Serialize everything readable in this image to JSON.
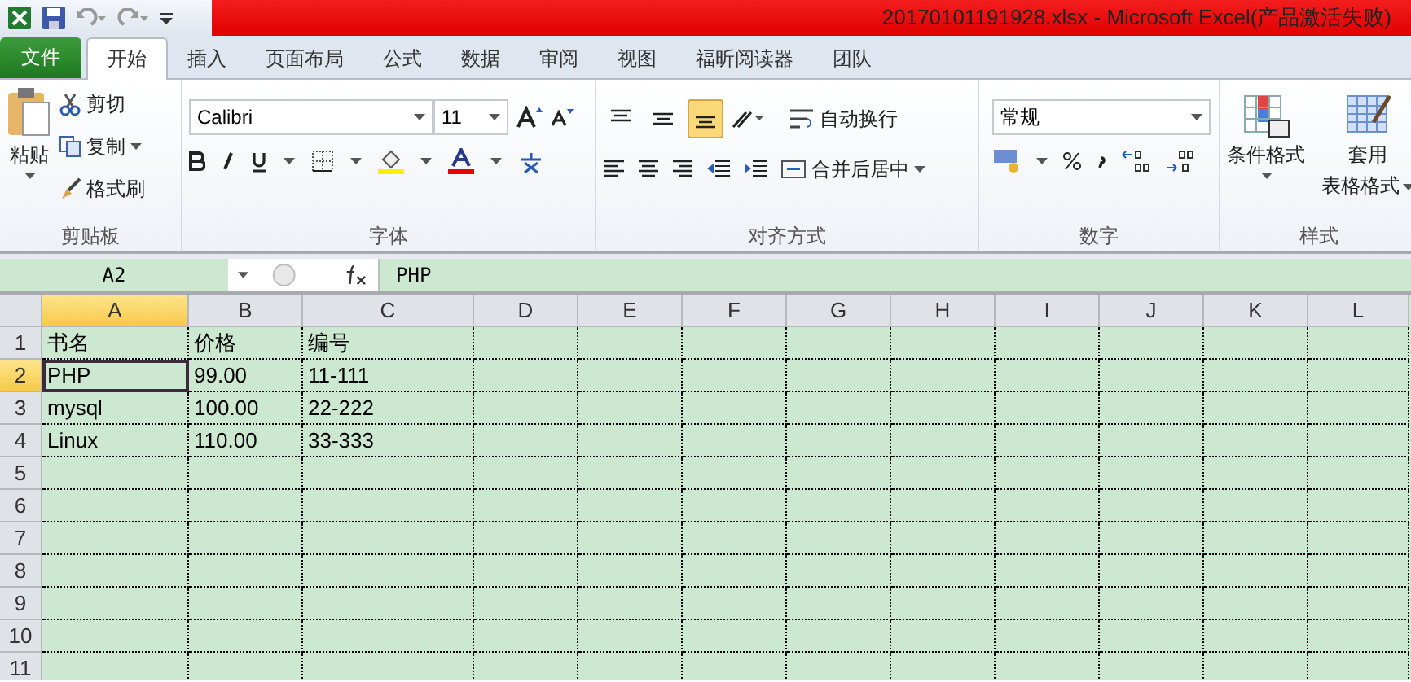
{
  "window": {
    "title": "20170101191928.xlsx  -  Microsoft Excel(产品激活失败)"
  },
  "file_menu": {
    "label": "文件"
  },
  "tabs": [
    {
      "label": "开始",
      "selected": true
    },
    {
      "label": "插入",
      "selected": false
    },
    {
      "label": "页面布局",
      "selected": false
    },
    {
      "label": "公式",
      "selected": false
    },
    {
      "label": "数据",
      "selected": false
    },
    {
      "label": "审阅",
      "selected": false
    },
    {
      "label": "视图",
      "selected": false
    },
    {
      "label": "福昕阅读器",
      "selected": false
    },
    {
      "label": "团队",
      "selected": false
    }
  ],
  "ribbon": {
    "clipboard": {
      "label": "剪贴板",
      "paste": "粘贴",
      "cut": "剪切",
      "copy": "复制",
      "format_painter": "格式刷"
    },
    "font": {
      "label": "字体",
      "font_name": "Calibri",
      "font_size": "11"
    },
    "alignment": {
      "label": "对齐方式",
      "wrap_text": "自动换行",
      "merge_center": "合并后居中",
      "bottom_align_selected": true
    },
    "number": {
      "label": "数字",
      "format": "常规"
    },
    "styles": {
      "label": "样式",
      "conditional_format": "条件格式",
      "format_as_table_1": "套用",
      "format_as_table_2": "表格格式"
    }
  },
  "formula_bar": {
    "name_box": "A2",
    "formula": "PHP"
  },
  "sheet": {
    "columns": [
      {
        "label": "A",
        "selected": true
      },
      {
        "label": "B",
        "selected": false
      },
      {
        "label": "C",
        "selected": false
      },
      {
        "label": "D",
        "selected": false
      },
      {
        "label": "E",
        "selected": false
      },
      {
        "label": "F",
        "selected": false
      },
      {
        "label": "G",
        "selected": false
      },
      {
        "label": "H",
        "selected": false
      },
      {
        "label": "I",
        "selected": false
      },
      {
        "label": "J",
        "selected": false
      },
      {
        "label": "K",
        "selected": false
      },
      {
        "label": "L",
        "selected": false
      }
    ],
    "rows": [
      {
        "number": "1",
        "selected": false,
        "cells": [
          "书名",
          "价格",
          "编号"
        ]
      },
      {
        "number": "2",
        "selected": true,
        "cells": [
          "PHP",
          "99.00",
          "11-111"
        ]
      },
      {
        "number": "3",
        "selected": false,
        "cells": [
          "mysql",
          "100.00",
          "22-222"
        ]
      },
      {
        "number": "4",
        "selected": false,
        "cells": [
          "Linux",
          "110.00",
          "33-333"
        ]
      },
      {
        "number": "5",
        "selected": false,
        "cells": []
      },
      {
        "number": "6",
        "selected": false,
        "cells": []
      },
      {
        "number": "7",
        "selected": false,
        "cells": []
      },
      {
        "number": "8",
        "selected": false,
        "cells": []
      },
      {
        "number": "9",
        "selected": false,
        "cells": []
      },
      {
        "number": "10",
        "selected": false,
        "cells": []
      },
      {
        "number": "11",
        "selected": false,
        "cells": []
      }
    ]
  }
}
